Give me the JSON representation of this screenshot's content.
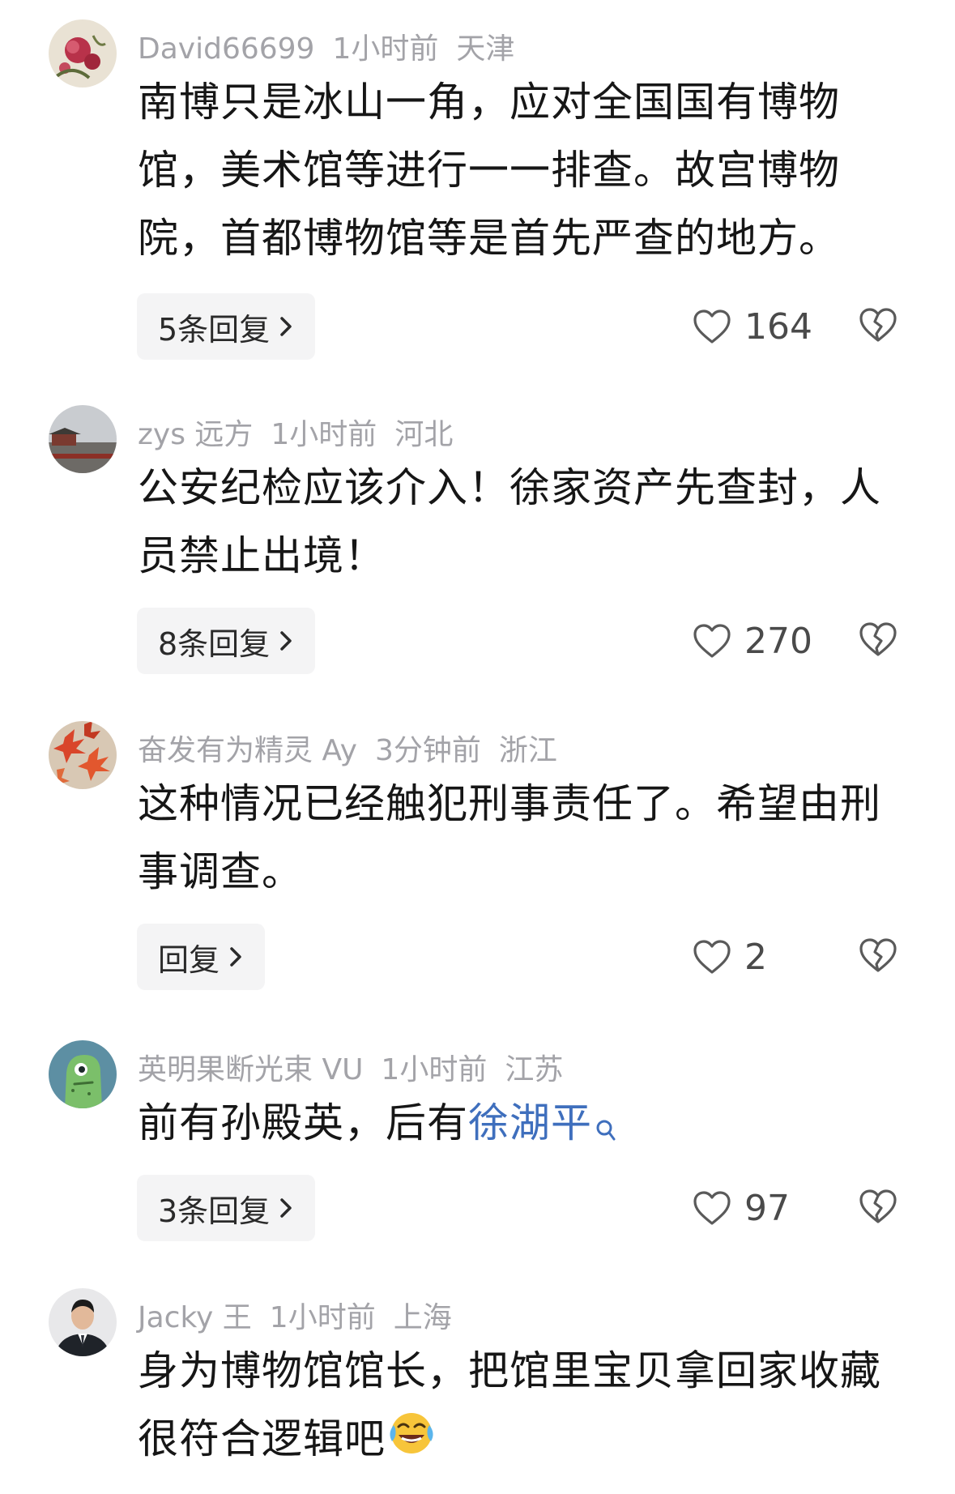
{
  "comments": [
    {
      "username": "David66699",
      "time": "1小时前",
      "location": "天津",
      "text": "南博只是冰山一角，应对全国国有博物馆，美术馆等进行一一排查。故宫博物院，首都博物馆等是首先严查的地方。",
      "replies": "5条回复",
      "likes": "164",
      "avatar": "peony-painting-avatar"
    },
    {
      "username": "zys 远方",
      "time": "1小时前",
      "location": "河北",
      "text": "公安纪检应该介入！徐家资产先查封，人员禁止出境！",
      "replies": "8条回复",
      "likes": "270",
      "avatar": "forbidden-city-avatar"
    },
    {
      "username": "奋发有为精灵 Ay",
      "time": "3分钟前",
      "location": "浙江",
      "text": "这种情况已经触犯刑事责任了。希望由刑事调查。",
      "replies": "回复",
      "likes": "2",
      "avatar": "maple-leaves-avatar"
    },
    {
      "username": "英明果断光束 VU",
      "time": "1小时前",
      "location": "江苏",
      "text_prefix": "前有孙殿英，后有",
      "text_link": "徐湖平",
      "replies": "3条回复",
      "likes": "97",
      "avatar": "cartoon-creature-avatar"
    },
    {
      "username": "Jacky 王",
      "time": "1小时前",
      "location": "上海",
      "text": "身为博物馆馆长，把馆里宝贝拿回家收藏很符合逻辑吧",
      "emoji": "laughing-crying-emoji",
      "avatar": "man-in-suit-avatar"
    }
  ],
  "colors": {
    "meta": "#a3a3a8",
    "link": "#3f6fbd",
    "reply_bg": "#f4f4f5"
  }
}
